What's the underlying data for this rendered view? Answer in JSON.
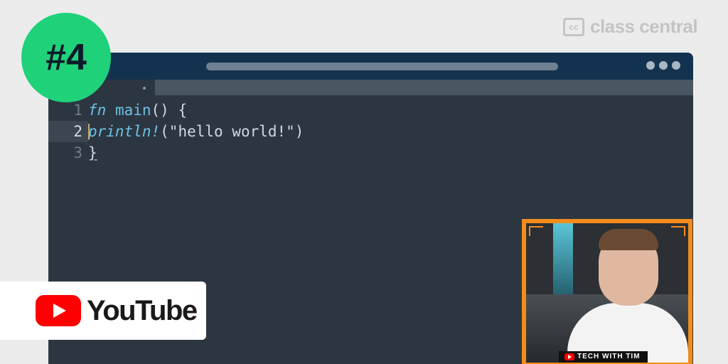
{
  "brand": {
    "logo_text": "cc",
    "name": "class central"
  },
  "badge": {
    "label": "#4"
  },
  "editor": {
    "lines": [
      {
        "number": "1",
        "tokens": [
          "fn",
          " ",
          "main",
          "() {"
        ]
      },
      {
        "number": "2",
        "tokens": [
          "println!",
          "(\"hello world!\")"
        ]
      },
      {
        "number": "3",
        "tokens": [
          "}"
        ]
      }
    ],
    "active_line": 2
  },
  "youtube": {
    "label": "YouTube"
  },
  "webcam": {
    "channel_label": "TECH WITH TIM"
  },
  "colors": {
    "badge": "#1fd27a",
    "titlebar": "#13324f",
    "editor_bg": "#2b3641",
    "keyword": "#6ec1e4",
    "webcam_frame": "#f28c1c",
    "youtube_red": "#ff0000"
  }
}
